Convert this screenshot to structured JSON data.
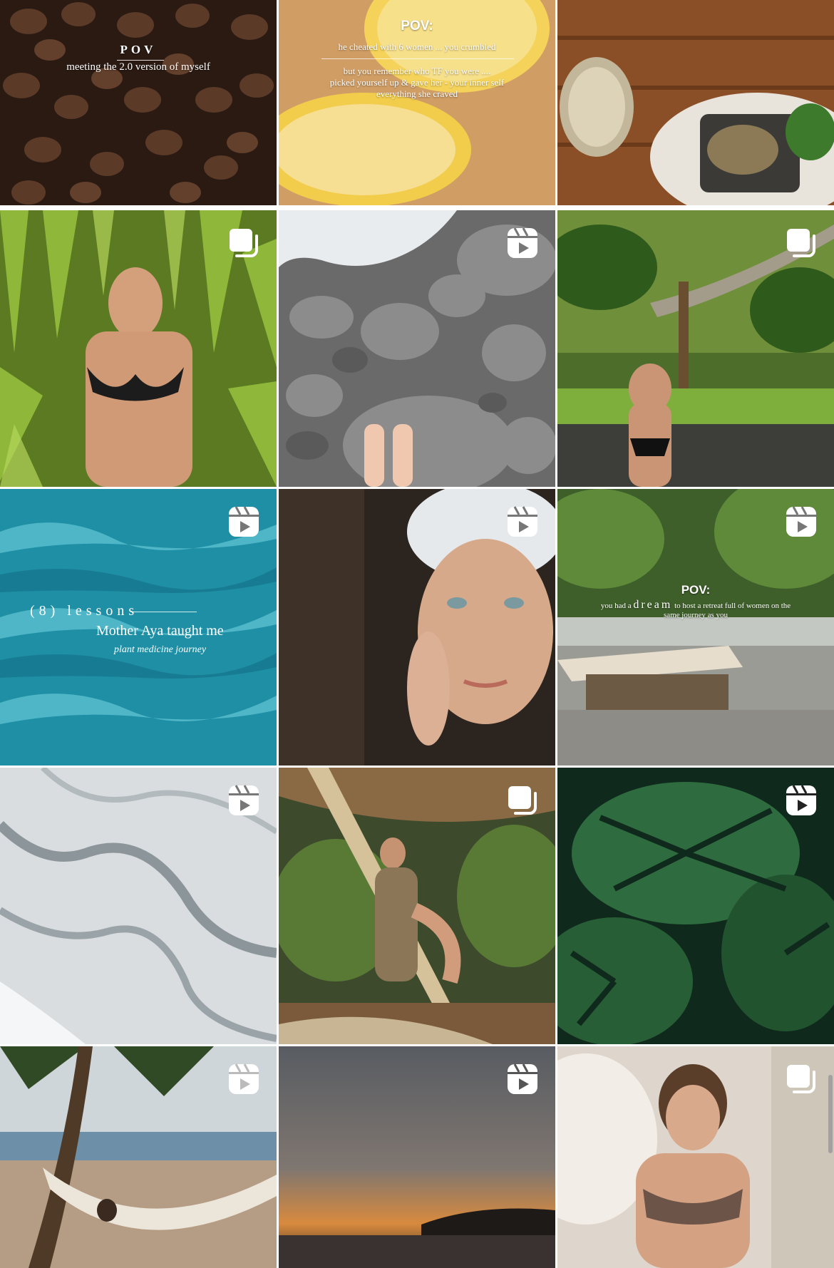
{
  "grid": {
    "posts": [
      {
        "id": "coffee-beans",
        "type": "photo",
        "badge": "none",
        "overlay": {
          "pov": "POV",
          "line1": "meeting the 2.0 version of myself"
        }
      },
      {
        "id": "lemons",
        "type": "photo",
        "badge": "none",
        "overlay": {
          "pov": "POV:",
          "line1": "he cheated with 6 women ... you crumbled",
          "line2": "but you remember who TF you were ....",
          "line3": "picked yourself up & gave her - your inner self",
          "line4": "everything she craved"
        }
      },
      {
        "id": "coconut-bowl",
        "type": "photo",
        "badge": "none"
      },
      {
        "id": "palm-bikini",
        "type": "carousel",
        "badge": "carousel-icon"
      },
      {
        "id": "pebbles-feet",
        "type": "reel",
        "badge": "reels-icon"
      },
      {
        "id": "garden-pose",
        "type": "carousel",
        "badge": "carousel-icon"
      },
      {
        "id": "water-lessons",
        "type": "reel",
        "badge": "reels-icon",
        "overlay": {
          "line1": "(8) lessons",
          "line2": "Mother Aya taught me",
          "line3": "plant medicine journey"
        }
      },
      {
        "id": "towel-face",
        "type": "reel",
        "badge": "reels-icon"
      },
      {
        "id": "retreat",
        "type": "reel",
        "badge": "reels-icon",
        "overlay": {
          "pov": "POV:",
          "pre": "you had a",
          "dream": "dream",
          "post": "to host a retreat full of women on the",
          "line2": "same journey as you"
        }
      },
      {
        "id": "sand-waves",
        "type": "reel",
        "badge": "reels-icon"
      },
      {
        "id": "hut-pose",
        "type": "carousel",
        "badge": "carousel-icon"
      },
      {
        "id": "monstera",
        "type": "reel",
        "badge": "reels-icon"
      },
      {
        "id": "hammock",
        "type": "reel",
        "badge": "reels-icon"
      },
      {
        "id": "sunset",
        "type": "reel",
        "badge": "reels-icon"
      },
      {
        "id": "short-hair",
        "type": "carousel",
        "badge": "carousel-icon"
      }
    ]
  },
  "colors": {
    "badge": "#ffffff",
    "background": "#ffffff"
  }
}
